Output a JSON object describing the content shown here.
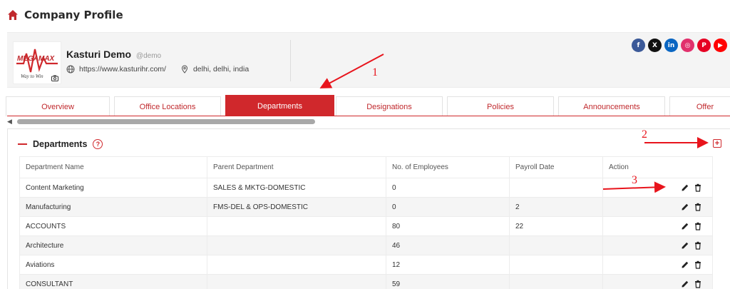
{
  "page": {
    "title": "Company Profile"
  },
  "company": {
    "name": "Kasturi Demo",
    "handle": "@demo",
    "website": "https://www.kasturihr.com/",
    "location": "delhi, delhi, india",
    "logo_text": "MEGAMAX",
    "logo_tagline": "Way to Win"
  },
  "social": [
    {
      "icon": "facebook-icon",
      "label": "f",
      "color": "#3b5998"
    },
    {
      "icon": "x-icon",
      "label": "X",
      "color": "#111111"
    },
    {
      "icon": "linkedin-icon",
      "label": "in",
      "color": "#0a66c2"
    },
    {
      "icon": "instagram-icon",
      "label": "◎",
      "color": "#e1306c"
    },
    {
      "icon": "pinterest-icon",
      "label": "P",
      "color": "#e60023"
    },
    {
      "icon": "youtube-icon",
      "label": "▶",
      "color": "#ff0000"
    }
  ],
  "tabs": [
    "Overview",
    "Office Locations",
    "Departments",
    "Designations",
    "Policies",
    "Announcements",
    "Offer"
  ],
  "active_tab": "Departments",
  "section": {
    "title": "Departments"
  },
  "table": {
    "headers": [
      "Department Name",
      "Parent Department",
      "No. of Employees",
      "Payroll Date",
      "Action"
    ],
    "rows": [
      [
        "Content Marketing",
        "SALES & MKTG-DOMESTIC",
        "0",
        ""
      ],
      [
        "Manufacturing",
        "FMS-DEL & OPS-DOMESTIC",
        "0",
        "2"
      ],
      [
        "ACCOUNTS",
        "",
        "80",
        "22"
      ],
      [
        "Architecture",
        "",
        "46",
        ""
      ],
      [
        "Aviations",
        "",
        "12",
        ""
      ],
      [
        "CONSULTANT",
        "",
        "59",
        ""
      ]
    ]
  },
  "annotations": [
    "1",
    "2",
    "3"
  ],
  "colors": {
    "accent": "#d0282c",
    "annotation": "#e8141c"
  }
}
